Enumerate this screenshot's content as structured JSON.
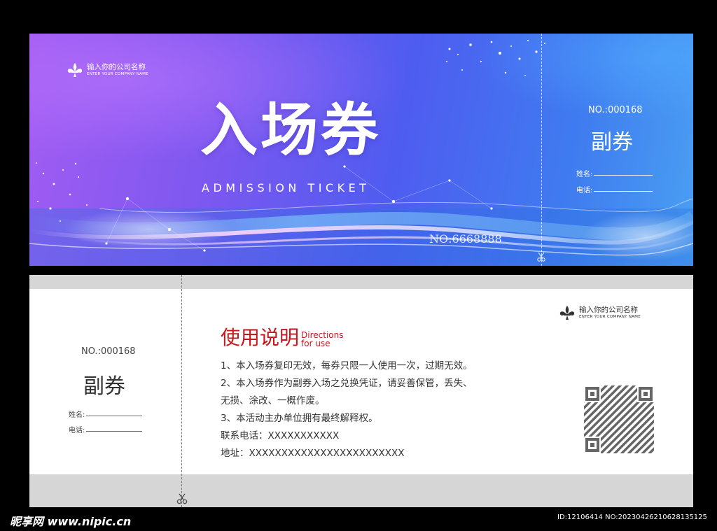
{
  "front": {
    "logo": {
      "line1": "输入你的公司名称",
      "line2": "ENTER YOUR COMPANY NAME"
    },
    "title": "入场券",
    "subtitle": "ADMISSION TICKET",
    "serial": "NO:6668888",
    "stub": {
      "number": "NO.:000168",
      "label": "副券",
      "name_label": "姓名:",
      "phone_label": "电话:"
    }
  },
  "back": {
    "logo": {
      "line1": "输入你的公司名称",
      "line2": "ENTER YOUR COMPANY NAME"
    },
    "stub": {
      "number": "NO.:000168",
      "label": "副券",
      "name_label": "姓名:",
      "phone_label": "电话:"
    },
    "instructions": {
      "heading": "使用说明",
      "heading_en_1": "Directions",
      "heading_en_2": "for use",
      "lines": [
        "1、本入场券复印无效，每券只限一人使用一次，过期无效。",
        "2、本入场券作为副券入场之兑换凭证，请妥善保管，丢失、",
        "无损、涂改、一概作废。",
        "3、本活动主办单位拥有最终解释权。",
        "联系电话：XXXXXXXXXXX",
        "地址：XXXXXXXXXXXXXXXXXXXXXXXX"
      ]
    },
    "qr_icon": "qr-code-icon"
  },
  "watermark": {
    "left": "昵享网 www.nipic.cn",
    "right": "ID:12106414 NO:20230426210628135125"
  },
  "colors": {
    "front_gradient_start": "#a25cf2",
    "front_gradient_end": "#4aa0f2",
    "heading_red": "#c8161d",
    "gray_band": "#d6d6d6"
  }
}
